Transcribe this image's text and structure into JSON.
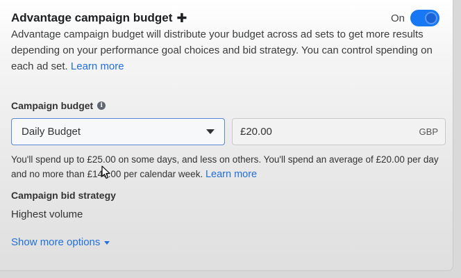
{
  "advantage": {
    "title": "Advantage campaign budget",
    "plus_symbol": "✚",
    "toggle_label": "On",
    "toggle_on": true,
    "description": "Advantage campaign budget will distribute your budget across ad sets to get more results depending on your performance goal choices and bid strategy. You can control spending on each ad set.",
    "learn_more": "Learn more"
  },
  "budget": {
    "label": "Campaign budget",
    "info_symbol": "i",
    "type_selected": "Daily Budget",
    "amount": "£20.00",
    "currency": "GBP",
    "spend_note": "You'll spend up to £25.00 on some days, and less on others. You'll spend an average of £20.00 per day and no more than £140.00 per calendar week.",
    "learn_more": "Learn more"
  },
  "bid_strategy": {
    "label": "Campaign bid strategy",
    "value": "Highest volume"
  },
  "show_more": {
    "label": "Show more options"
  },
  "colors": {
    "accent": "#1877f2",
    "link": "#216fdb"
  }
}
